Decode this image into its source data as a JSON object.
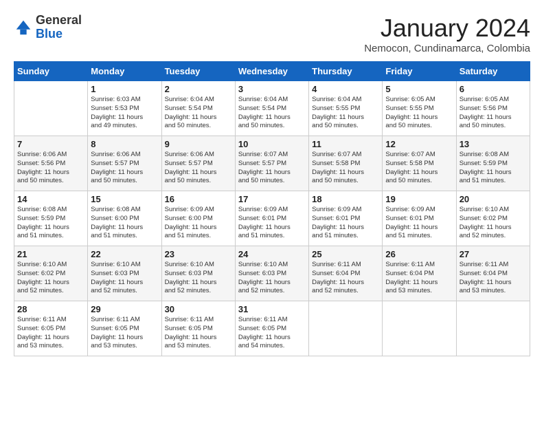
{
  "header": {
    "logo_general": "General",
    "logo_blue": "Blue",
    "month_year": "January 2024",
    "location": "Nemocon, Cundinamarca, Colombia"
  },
  "days_of_week": [
    "Sunday",
    "Monday",
    "Tuesday",
    "Wednesday",
    "Thursday",
    "Friday",
    "Saturday"
  ],
  "weeks": [
    [
      {
        "day": "",
        "info": ""
      },
      {
        "day": "1",
        "info": "Sunrise: 6:03 AM\nSunset: 5:53 PM\nDaylight: 11 hours\nand 49 minutes."
      },
      {
        "day": "2",
        "info": "Sunrise: 6:04 AM\nSunset: 5:54 PM\nDaylight: 11 hours\nand 50 minutes."
      },
      {
        "day": "3",
        "info": "Sunrise: 6:04 AM\nSunset: 5:54 PM\nDaylight: 11 hours\nand 50 minutes."
      },
      {
        "day": "4",
        "info": "Sunrise: 6:04 AM\nSunset: 5:55 PM\nDaylight: 11 hours\nand 50 minutes."
      },
      {
        "day": "5",
        "info": "Sunrise: 6:05 AM\nSunset: 5:55 PM\nDaylight: 11 hours\nand 50 minutes."
      },
      {
        "day": "6",
        "info": "Sunrise: 6:05 AM\nSunset: 5:56 PM\nDaylight: 11 hours\nand 50 minutes."
      }
    ],
    [
      {
        "day": "7",
        "info": "Sunrise: 6:06 AM\nSunset: 5:56 PM\nDaylight: 11 hours\nand 50 minutes."
      },
      {
        "day": "8",
        "info": "Sunrise: 6:06 AM\nSunset: 5:57 PM\nDaylight: 11 hours\nand 50 minutes."
      },
      {
        "day": "9",
        "info": "Sunrise: 6:06 AM\nSunset: 5:57 PM\nDaylight: 11 hours\nand 50 minutes."
      },
      {
        "day": "10",
        "info": "Sunrise: 6:07 AM\nSunset: 5:57 PM\nDaylight: 11 hours\nand 50 minutes."
      },
      {
        "day": "11",
        "info": "Sunrise: 6:07 AM\nSunset: 5:58 PM\nDaylight: 11 hours\nand 50 minutes."
      },
      {
        "day": "12",
        "info": "Sunrise: 6:07 AM\nSunset: 5:58 PM\nDaylight: 11 hours\nand 50 minutes."
      },
      {
        "day": "13",
        "info": "Sunrise: 6:08 AM\nSunset: 5:59 PM\nDaylight: 11 hours\nand 51 minutes."
      }
    ],
    [
      {
        "day": "14",
        "info": "Sunrise: 6:08 AM\nSunset: 5:59 PM\nDaylight: 11 hours\nand 51 minutes."
      },
      {
        "day": "15",
        "info": "Sunrise: 6:08 AM\nSunset: 6:00 PM\nDaylight: 11 hours\nand 51 minutes."
      },
      {
        "day": "16",
        "info": "Sunrise: 6:09 AM\nSunset: 6:00 PM\nDaylight: 11 hours\nand 51 minutes."
      },
      {
        "day": "17",
        "info": "Sunrise: 6:09 AM\nSunset: 6:01 PM\nDaylight: 11 hours\nand 51 minutes."
      },
      {
        "day": "18",
        "info": "Sunrise: 6:09 AM\nSunset: 6:01 PM\nDaylight: 11 hours\nand 51 minutes."
      },
      {
        "day": "19",
        "info": "Sunrise: 6:09 AM\nSunset: 6:01 PM\nDaylight: 11 hours\nand 51 minutes."
      },
      {
        "day": "20",
        "info": "Sunrise: 6:10 AM\nSunset: 6:02 PM\nDaylight: 11 hours\nand 52 minutes."
      }
    ],
    [
      {
        "day": "21",
        "info": "Sunrise: 6:10 AM\nSunset: 6:02 PM\nDaylight: 11 hours\nand 52 minutes."
      },
      {
        "day": "22",
        "info": "Sunrise: 6:10 AM\nSunset: 6:03 PM\nDaylight: 11 hours\nand 52 minutes."
      },
      {
        "day": "23",
        "info": "Sunrise: 6:10 AM\nSunset: 6:03 PM\nDaylight: 11 hours\nand 52 minutes."
      },
      {
        "day": "24",
        "info": "Sunrise: 6:10 AM\nSunset: 6:03 PM\nDaylight: 11 hours\nand 52 minutes."
      },
      {
        "day": "25",
        "info": "Sunrise: 6:11 AM\nSunset: 6:04 PM\nDaylight: 11 hours\nand 52 minutes."
      },
      {
        "day": "26",
        "info": "Sunrise: 6:11 AM\nSunset: 6:04 PM\nDaylight: 11 hours\nand 53 minutes."
      },
      {
        "day": "27",
        "info": "Sunrise: 6:11 AM\nSunset: 6:04 PM\nDaylight: 11 hours\nand 53 minutes."
      }
    ],
    [
      {
        "day": "28",
        "info": "Sunrise: 6:11 AM\nSunset: 6:05 PM\nDaylight: 11 hours\nand 53 minutes."
      },
      {
        "day": "29",
        "info": "Sunrise: 6:11 AM\nSunset: 6:05 PM\nDaylight: 11 hours\nand 53 minutes."
      },
      {
        "day": "30",
        "info": "Sunrise: 6:11 AM\nSunset: 6:05 PM\nDaylight: 11 hours\nand 53 minutes."
      },
      {
        "day": "31",
        "info": "Sunrise: 6:11 AM\nSunset: 6:05 PM\nDaylight: 11 hours\nand 54 minutes."
      },
      {
        "day": "",
        "info": ""
      },
      {
        "day": "",
        "info": ""
      },
      {
        "day": "",
        "info": ""
      }
    ]
  ]
}
